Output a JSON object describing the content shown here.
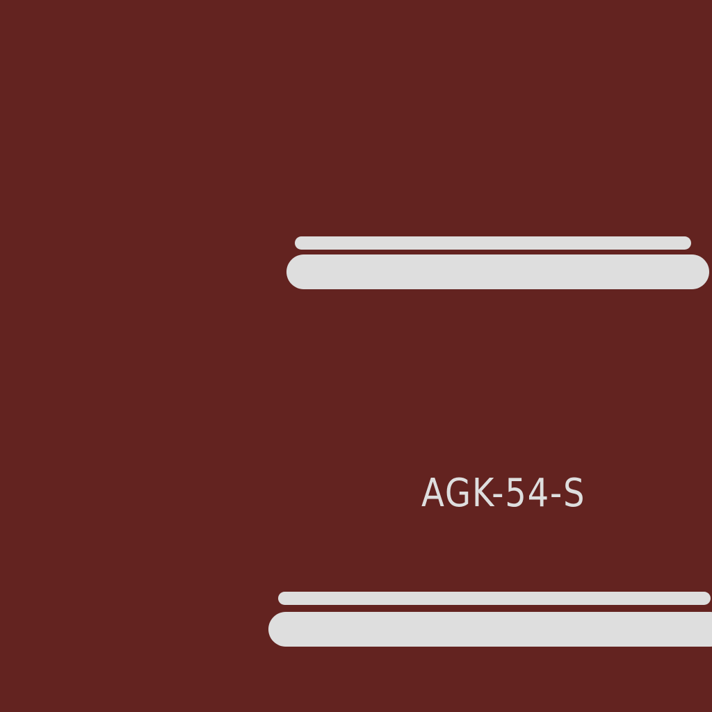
{
  "label": {
    "code": "AGK-54-S"
  },
  "colors": {
    "background": "#632320",
    "stripe": "#dedede",
    "text": "#dedede"
  }
}
